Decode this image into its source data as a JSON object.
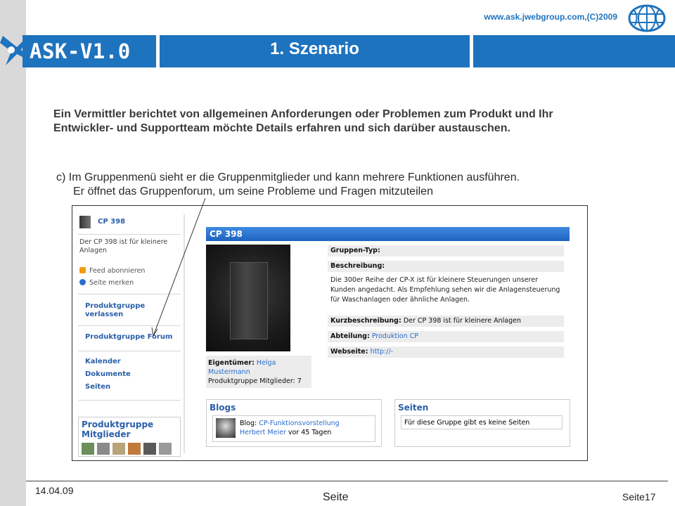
{
  "header": {
    "app_title": "ASK-V1.0",
    "slide_title": "1. Szenario",
    "website": "www.ask.jwebgroup.com,(C)2009"
  },
  "body": {
    "intro": "Ein Vermittler berichtet von allgemeinen Anforderungen oder Problemen zum Produkt und Ihr Entwickler- und Supportteam möchte Details erfahren und sich darüber austauschen.",
    "item_line1": "c) Im Gruppenmenü sieht er die Gruppenmitglieder und kann mehrere Funktionen ausführen.",
    "item_line2": "Er öffnet das Gruppenforum, um seine Probleme und Fragen mitzuteilen"
  },
  "screenshot": {
    "sidebar": {
      "group_name": "CP 398",
      "description": "Der CP 398 ist für kleinere Anlagen",
      "feed": "Feed abonnieren",
      "bookmark": "Seite merken",
      "leave_line1": "Produktgruppe",
      "leave_line2": "verlassen",
      "forum": "Produktgruppe Forum",
      "calendar": "Kalender",
      "documents": "Dokumente",
      "pages": "Seiten",
      "members_line1": "Produktgruppe",
      "members_line2": "Mitglieder"
    },
    "main": {
      "title": "CP 398",
      "owner_label": "Eigentümer:",
      "owner_name1": "Helga",
      "owner_name2": "Mustermann",
      "members_count": "Produktgruppe Mitglieder: 7",
      "group_type_label": "Gruppen-Typ:",
      "description_label": "Beschreibung:",
      "description_text": "Die 300er Reihe der CP-X ist für kleinere Steuerungen unserer Kunden angedacht. Als Empfehlung sehen wir die Anlagensteuerung für Waschanlagen oder ähnliche Anlagen.",
      "short_label": "Kurzbeschreibung:",
      "short_text": "Der CP 398 ist für kleinere Anlagen",
      "dept_label": "Abteilung:",
      "dept_value": "Produktion CP",
      "web_label": "Webseite:",
      "web_value": "http://-",
      "blogs_title": "Blogs",
      "blog_label": "Blog:",
      "blog_link": "CP-Funktionsvorstellung",
      "blog_author": "Herbert Meier",
      "blog_time": "vor 45 Tagen",
      "pages_title": "Seiten",
      "pages_text": "Für diese Gruppe gibt es keine Seiten"
    }
  },
  "footer": {
    "date": "14.04.09",
    "center": "Seite",
    "page_label": "Seite",
    "page_number": "17"
  },
  "colors": {
    "title_bar": "#1e73be",
    "link": "#2a5fa8",
    "website": "#1e73be"
  }
}
